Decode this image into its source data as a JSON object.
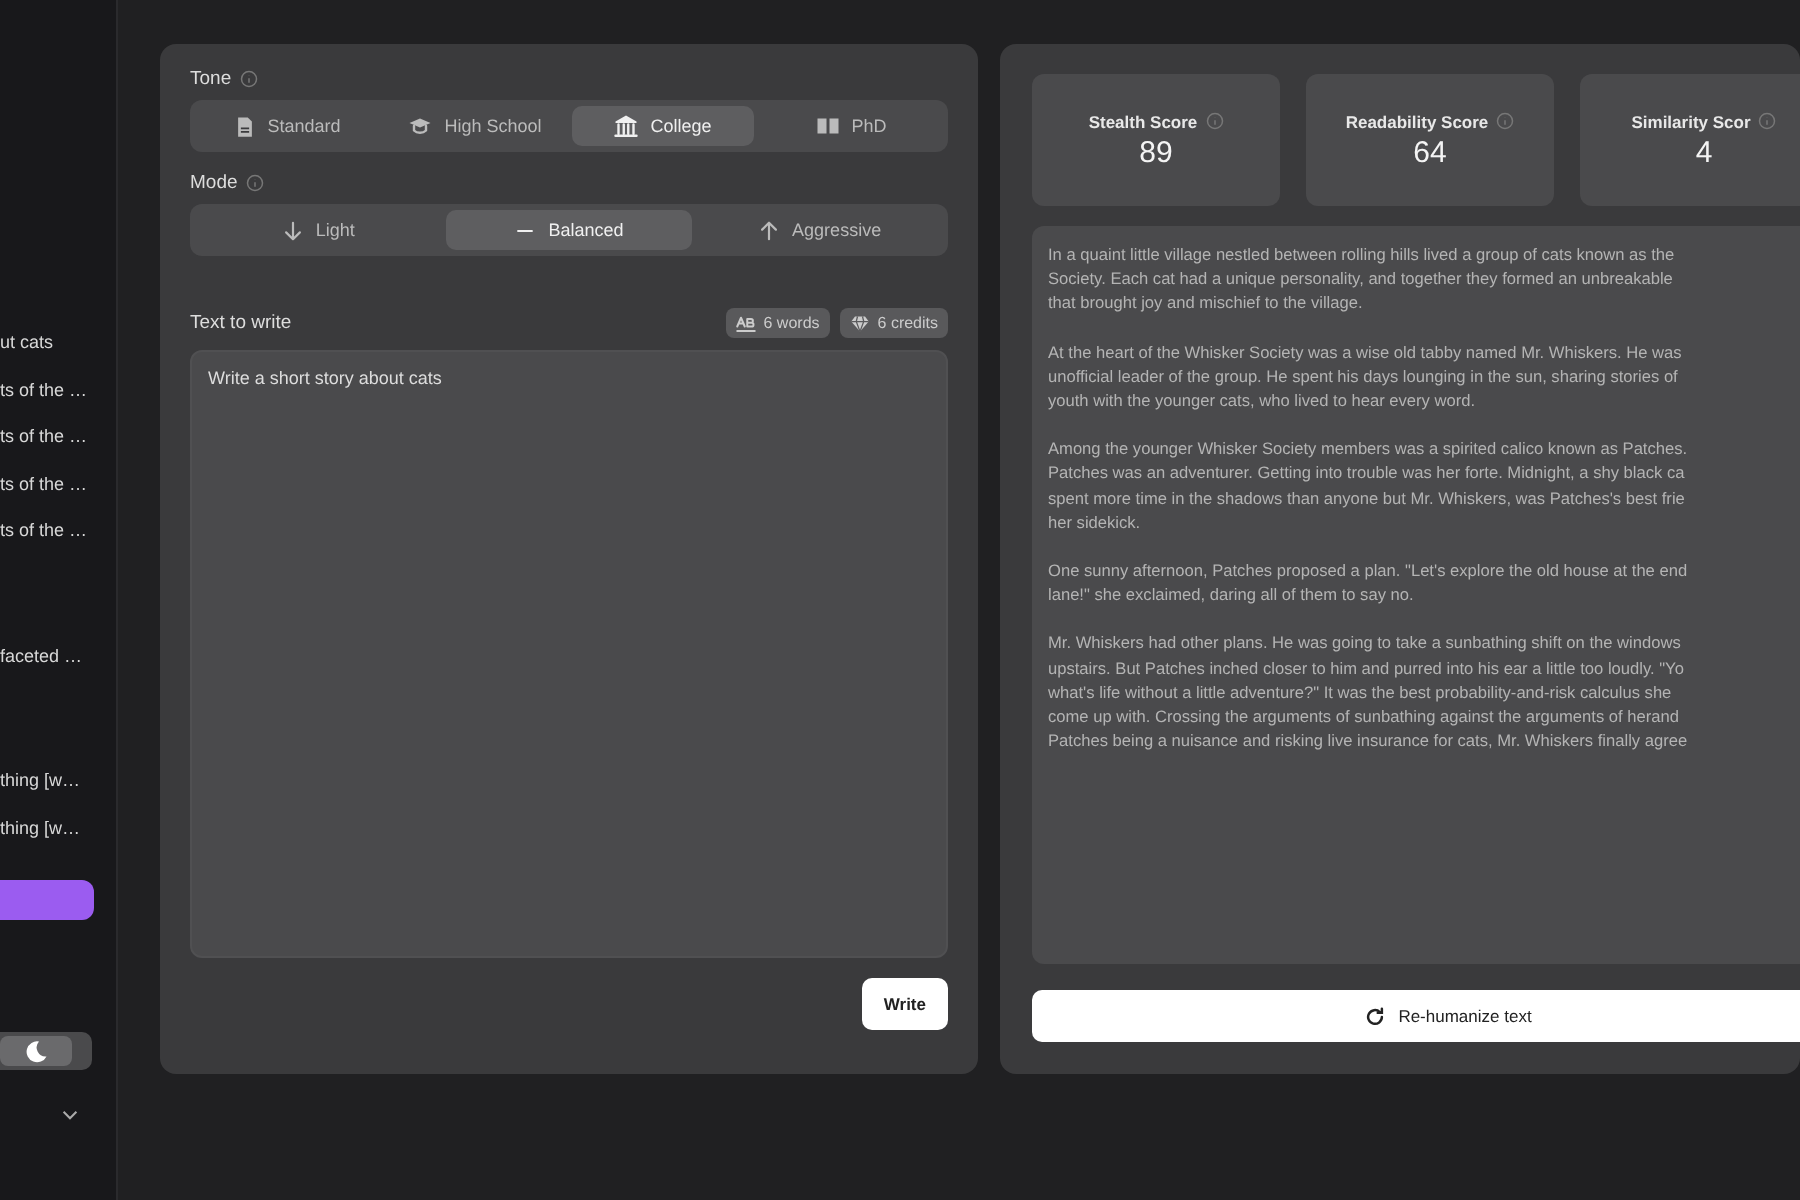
{
  "sidebar": {
    "groups": [
      [
        {
          "label": "ut cats"
        },
        {
          "label": "ts of the …"
        },
        {
          "label": "ts of the …"
        },
        {
          "label": "ts of the …"
        },
        {
          "label": "ts of the …"
        }
      ],
      [
        {
          "label": "faceted …"
        }
      ],
      [
        {
          "label": "thing [w…"
        },
        {
          "label": "thing [w…"
        }
      ]
    ],
    "dark_mode": true
  },
  "tone": {
    "label": "Tone",
    "options": [
      {
        "label": "Standard",
        "selected": false
      },
      {
        "label": "High School",
        "selected": false
      },
      {
        "label": "College",
        "selected": true
      },
      {
        "label": "PhD",
        "selected": false
      }
    ]
  },
  "mode": {
    "label": "Mode",
    "options": [
      {
        "label": "Light",
        "selected": false
      },
      {
        "label": "Balanced",
        "selected": true
      },
      {
        "label": "Aggressive",
        "selected": false
      }
    ]
  },
  "input": {
    "label": "Text to write",
    "badges": [
      {
        "kind": "words",
        "text": "6 words"
      },
      {
        "kind": "credits",
        "text": "6 credits"
      }
    ],
    "value": "Write a short story about cats"
  },
  "write_button": "Write",
  "scores": [
    {
      "label": "Stealth Score",
      "value": "89"
    },
    {
      "label": "Readability Score",
      "value": "64"
    },
    {
      "label": "Similarity Scor",
      "value": "4"
    }
  ],
  "output": {
    "paragraphs": [
      [
        "In a quaint little village nestled between rolling hills lived a group of cats known as the",
        "Society. Each cat had a unique personality, and together they formed an unbreakable",
        "that brought joy and mischief to the village."
      ],
      [
        "At the heart of the Whisker Society was a wise old tabby named Mr. Whiskers. He was",
        "unofficial leader of the group. He spent his days lounging in the sun, sharing stories of",
        "youth with the younger cats, who lived to hear every word."
      ],
      [
        "Among the younger Whisker Society members was a spirited calico known as Patches.",
        "Patches was an adventurer. Getting into trouble was her forte. Midnight, a shy black ca",
        "spent more time in the shadows than anyone but Mr. Whiskers, was Patches's best frie",
        "her sidekick."
      ],
      [
        "One sunny afternoon, Patches proposed a plan. \"Let's explore the old house at the end",
        "lane!\" she exclaimed, daring all of them to say no."
      ],
      [
        "Mr. Whiskers had other plans. He was going to take a sunbathing shift on the windows",
        "upstairs. But Patches inched closer to him and purred into his ear a little too loudly. \"Yo",
        "what's life without a little adventure?\" It was the best probability-and-risk calculus she",
        "come up with. Crossing the arguments of sunbathing against the arguments of herand",
        "Patches being a nuisance and risking live insurance for cats, Mr. Whiskers finally agree"
      ]
    ]
  },
  "rehumanize_button": "Re-humanize text"
}
